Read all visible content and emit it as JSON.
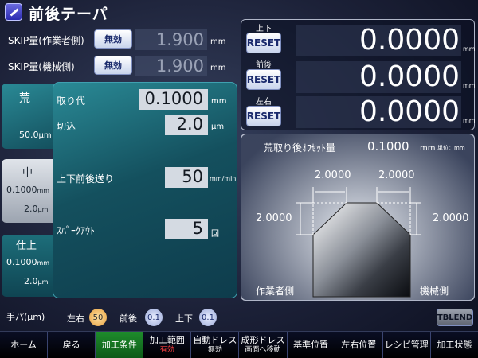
{
  "title": "前後テーパ",
  "skip": {
    "worker_label": "SKIP量(作業者側)",
    "machine_label": "SKIP量(機械側)",
    "worker_btn": "無効",
    "machine_btn": "無効",
    "worker_value": "1.900",
    "machine_value": "1.900",
    "unit": "mm"
  },
  "tabs": {
    "rough": {
      "label": "荒",
      "value": "50.0",
      "unit": "μm"
    },
    "medium": {
      "label": "中",
      "value1": "0.1000",
      "unit1": "mm",
      "value2": "2.0",
      "unit2": "μm"
    },
    "finish": {
      "label": "仕上",
      "value1": "0.1000",
      "unit1": "mm",
      "value2": "2.0",
      "unit2": "μm"
    }
  },
  "conditions": {
    "allowance_label": "取り代",
    "allowance_value": "0.1000",
    "allowance_unit": "mm",
    "cut_label": "切込",
    "cut_value": "2.0",
    "cut_unit": "μm",
    "feed_label": "上下前後送り",
    "feed_value": "50",
    "feed_unit": "mm/min",
    "spark_label": "ｽﾊﾟｰｸｱｳﾄ",
    "spark_value": "5",
    "spark_unit": "回"
  },
  "counters": [
    {
      "label": "上下",
      "reset": "RESET",
      "value": "0.0000",
      "unit": "mm"
    },
    {
      "label": "前後",
      "reset": "RESET",
      "value": "0.0000",
      "unit": "mm"
    },
    {
      "label": "左右",
      "reset": "RESET",
      "value": "0.0000",
      "unit": "mm"
    }
  ],
  "diagram": {
    "offset_label": "荒取り後ｵﾌｾｯﾄ量",
    "offset_value": "0.1000",
    "offset_unit": "mm",
    "unit_note": "単位：mm",
    "top_left": "2.0000",
    "top_right": "2.0000",
    "left": "2.0000",
    "right": "2.0000",
    "worker_side": "作業者側",
    "machine_side": "機械側"
  },
  "handle": {
    "label": "手パ(μm)",
    "lr_label": "左右",
    "lr_value": "50",
    "fb_label": "前後",
    "fb_value": "0.1",
    "ud_label": "上下",
    "ud_value": "0.1",
    "tblend": "TBLEND"
  },
  "nav": [
    {
      "label": "ホーム",
      "sub": ""
    },
    {
      "label": "戻る",
      "sub": ""
    },
    {
      "label": "加工条件",
      "sub": ""
    },
    {
      "label": "加工範囲",
      "sub": "有効"
    },
    {
      "label": "自動ドレス",
      "sub": "無効"
    },
    {
      "label": "成形ドレス",
      "sub": "画面へ移動"
    },
    {
      "label": "基準位置",
      "sub": ""
    },
    {
      "label": "左右位置",
      "sub": ""
    },
    {
      "label": "レシピ管理",
      "sub": ""
    },
    {
      "label": "加工状態",
      "sub": ""
    }
  ],
  "colors": {
    "active_nav": "#1e8c2c",
    "teal_panel": "#1d6e7a",
    "sub_on": "#ff4040"
  }
}
